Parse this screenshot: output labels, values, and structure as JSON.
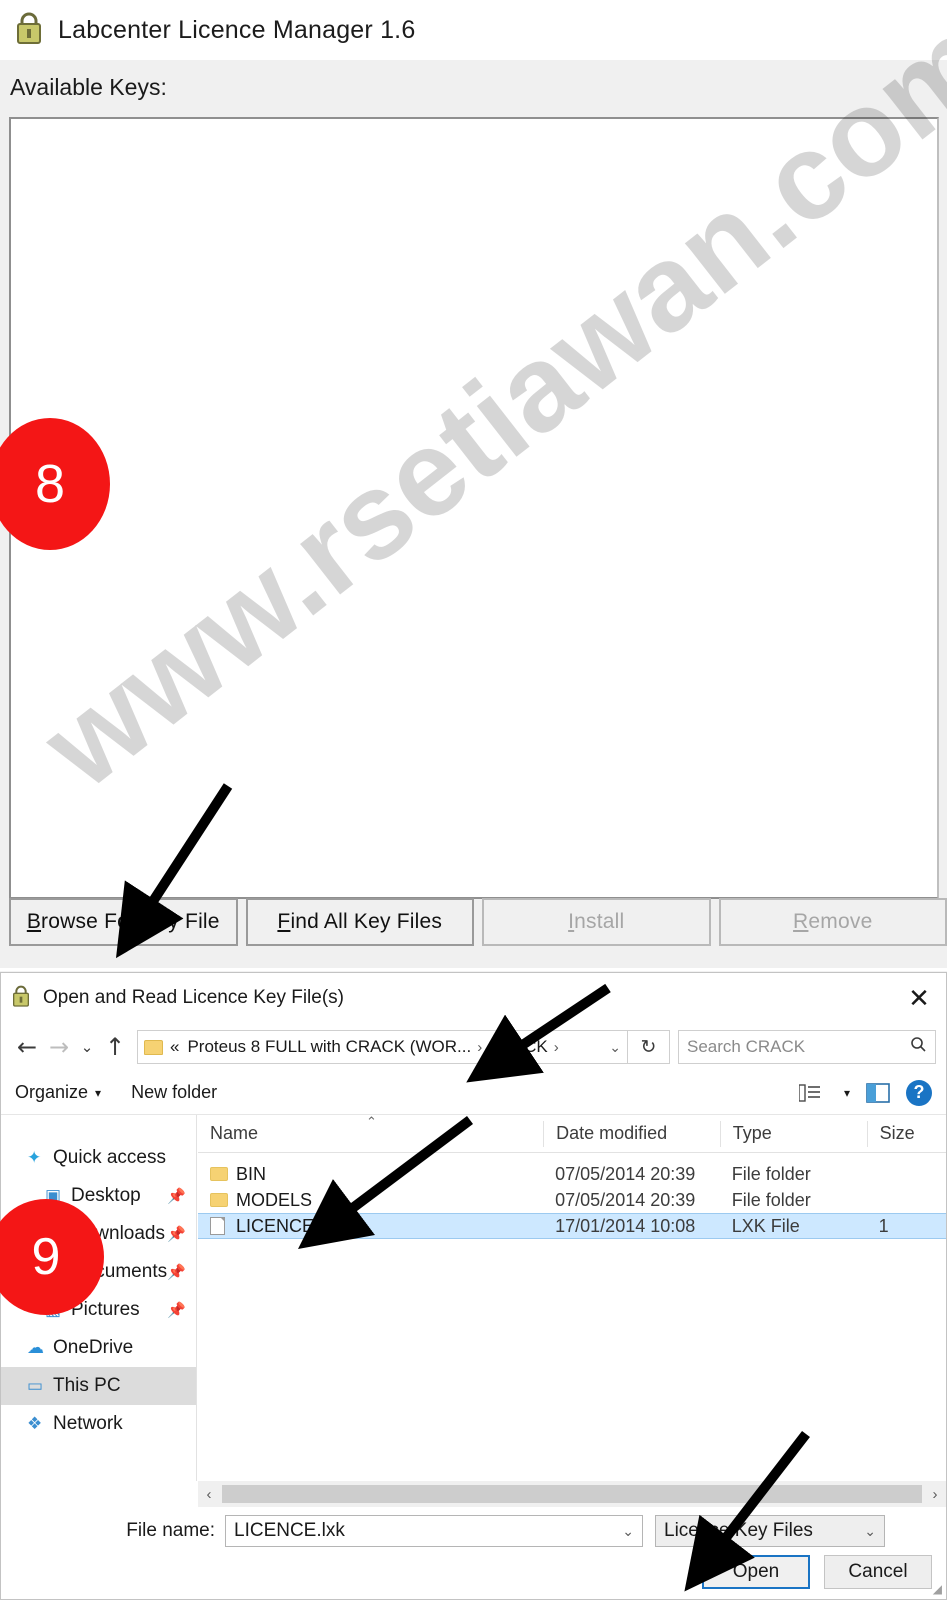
{
  "licence_manager": {
    "title": "Labcenter Licence Manager 1.6",
    "title_icon": "lock-icon",
    "available_keys_label": "Available Keys:",
    "list_items": [],
    "buttons": [
      {
        "accel": "B",
        "rest": "rowse For Key File",
        "label": "Browse For Key File",
        "disabled": false
      },
      {
        "accel": "F",
        "rest": "ind All Key Files",
        "label": "Find All Key Files",
        "disabled": false
      },
      {
        "accel": "I",
        "rest": "nstall",
        "label": "Install",
        "disabled": true
      },
      {
        "accel": "R",
        "rest": "emove",
        "label": "Remove",
        "disabled": true
      }
    ]
  },
  "file_dialog": {
    "title": "Open and Read Licence Key File(s)",
    "title_icon": "lock-icon",
    "close_label": "✕",
    "nav": {
      "back": "←",
      "forward": "→",
      "recent": "⌄",
      "up": "↑"
    },
    "address": {
      "prefix": "«",
      "crumbs": [
        "Proteus 8 FULL with CRACK (WOR...",
        "CRACK"
      ],
      "separator": "›",
      "caret": "⌄",
      "refresh": "↻"
    },
    "search": {
      "placeholder": "Search CRACK",
      "icon": "⌕"
    },
    "toolbar": {
      "organize": "Organize",
      "organize_caret": "▾",
      "new_folder": "New folder",
      "view_caret": "▾",
      "help": "?"
    },
    "nav_pane": [
      {
        "label": "Quick access",
        "icon": "★",
        "icon_color": "#29a3dd",
        "selected": false,
        "indent": false,
        "pinned": false
      },
      {
        "label": "Desktop",
        "icon": "■",
        "icon_color": "#3b8ed0",
        "selected": false,
        "indent": true,
        "pinned": true
      },
      {
        "label": "Downloads",
        "icon": "⬇",
        "icon_color": "#3b8ed0",
        "selected": false,
        "indent": true,
        "pinned": true
      },
      {
        "label": "Documents",
        "icon": "▤",
        "icon_color": "#3b8ed0",
        "selected": false,
        "indent": true,
        "pinned": true
      },
      {
        "label": "Pictures",
        "icon": "▧",
        "icon_color": "#3b8ed0",
        "selected": false,
        "indent": true,
        "pinned": true
      },
      {
        "label": "OneDrive",
        "icon": "☁",
        "icon_color": "#2a8fd8",
        "selected": false,
        "indent": false,
        "pinned": false
      },
      {
        "label": "This PC",
        "icon": "▭",
        "icon_color": "#3b8ed0",
        "selected": true,
        "indent": false,
        "pinned": false
      },
      {
        "label": "Network",
        "icon": "❖",
        "icon_color": "#3b8ed0",
        "selected": false,
        "indent": false,
        "pinned": false
      }
    ],
    "columns": [
      "Name",
      "Date modified",
      "Type",
      "Size"
    ],
    "sort_indicator": "⌃",
    "rows": [
      {
        "name": "BIN",
        "date": "07/05/2014 20:39",
        "type": "File folder",
        "size": "",
        "icon": "folder-icon",
        "selected": false
      },
      {
        "name": "MODELS",
        "date": "07/05/2014 20:39",
        "type": "File folder",
        "size": "",
        "icon": "folder-icon",
        "selected": false
      },
      {
        "name": "LICENCE.lxk",
        "date": "17/01/2014 10:08",
        "type": "LXK File",
        "size": "1",
        "icon": "file-icon",
        "selected": true
      }
    ],
    "hscroll": {
      "left": "‹",
      "right": "›"
    },
    "file_name_label": "File name:",
    "file_name_value": "LICENCE.lxk",
    "file_name_caret": "⌄",
    "filter_value": "Licence Key Files",
    "filter_caret": "⌄",
    "open_button": "Open",
    "cancel_button": "Cancel"
  },
  "annotations": {
    "badges": [
      {
        "number": "8"
      },
      {
        "number": "9"
      }
    ],
    "watermark": "www.rsetiawan.com"
  }
}
